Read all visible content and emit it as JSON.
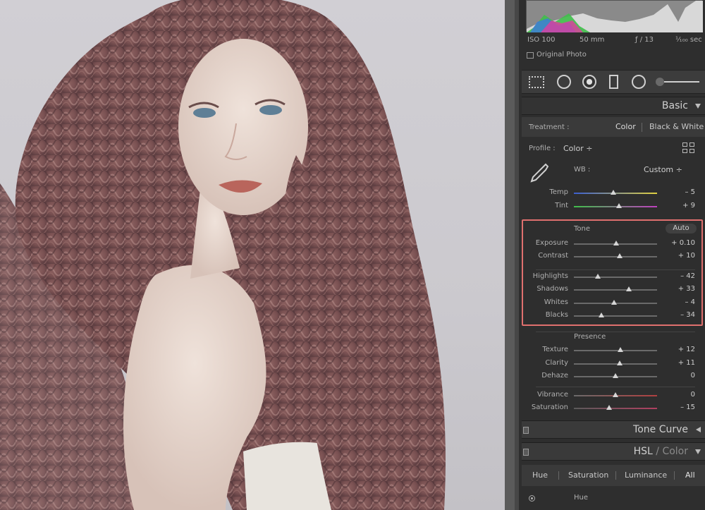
{
  "info": {
    "iso": "ISO 100",
    "focal": "50 mm",
    "aperture": "ƒ / 13",
    "shutter": "¹⁄₁₀₀ sec",
    "original_photo": "Original Photo"
  },
  "basic": {
    "title": "Basic",
    "treatment_label": "Treatment :",
    "treatment_color": "Color",
    "treatment_bw": "Black & White",
    "profile_label": "Profile :",
    "profile_value": "Color ÷",
    "wb_label": "WB :",
    "wb_value": "Custom ÷"
  },
  "sliders": {
    "temp": {
      "label": "Temp",
      "value": "– 5",
      "level": -5
    },
    "tint": {
      "label": "Tint",
      "value": "+ 9",
      "level": 9
    },
    "exposure": {
      "label": "Exposure",
      "value": "+ 0.10",
      "level": 2
    },
    "contrast": {
      "label": "Contrast",
      "value": "+ 10",
      "level": 10
    },
    "highlights": {
      "label": "Highlights",
      "value": "– 42",
      "level": -42
    },
    "shadows": {
      "label": "Shadows",
      "value": "+ 33",
      "level": 33
    },
    "whites": {
      "label": "Whites",
      "value": "– 4",
      "level": -4
    },
    "blacks": {
      "label": "Blacks",
      "value": "– 34",
      "level": -34
    },
    "texture": {
      "label": "Texture",
      "value": "+ 12",
      "level": 12
    },
    "clarity": {
      "label": "Clarity",
      "value": "+ 11",
      "level": 11
    },
    "dehaze": {
      "label": "Dehaze",
      "value": "0",
      "level": 0
    },
    "vibrance": {
      "label": "Vibrance",
      "value": "0",
      "level": 0
    },
    "saturation": {
      "label": "Saturation",
      "value": "– 15",
      "level": -15
    }
  },
  "tone": {
    "title": "Tone",
    "auto": "Auto"
  },
  "presence": {
    "title": "Presence"
  },
  "tone_curve": {
    "title": "Tone Curve"
  },
  "hsl": {
    "title_hsl": "HSL",
    "slash": " / ",
    "title_color": "Color",
    "tabs": [
      "Hue",
      "Saturation",
      "Luminance",
      "All"
    ],
    "sub_title": "Hue"
  },
  "colors": {
    "highlight_box": "#e0706e",
    "panel_bg": "#2e2e2e"
  }
}
